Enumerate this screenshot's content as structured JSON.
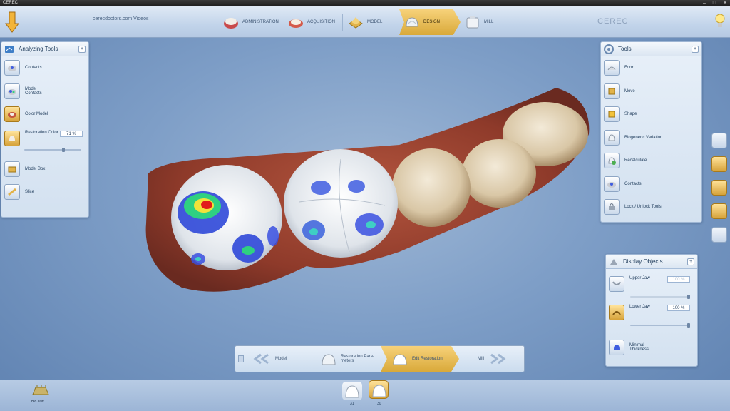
{
  "window": {
    "title": "CEREC",
    "controls": [
      "–",
      "□",
      "✕"
    ]
  },
  "header": {
    "site_label": "cerecdoctors.com Videos",
    "brand": "CEREC",
    "steps": [
      {
        "label": "ADMINISTRATION",
        "icon": "administration-icon",
        "active": false
      },
      {
        "label": "ACQUISITION",
        "icon": "acquisition-icon",
        "active": false
      },
      {
        "label": "MODEL",
        "icon": "model-icon",
        "active": false
      },
      {
        "label": "DESIGN",
        "icon": "design-icon",
        "active": true
      },
      {
        "label": "MILL",
        "icon": "mill-icon",
        "active": false
      }
    ]
  },
  "analyzing_tools": {
    "title": "Analyzing Tools",
    "items": [
      {
        "label": "Contacts",
        "icon": "contacts-icon"
      },
      {
        "label": "Model Contacts",
        "icon": "model-contacts-icon"
      },
      {
        "label": "Color Model",
        "icon": "color-model-icon"
      },
      {
        "label": "Restoration Color",
        "icon": "restoration-color-icon",
        "value": "71 %",
        "level_pct": 71
      },
      {
        "label": "Model Box",
        "icon": "model-box-icon"
      },
      {
        "label": "Slice",
        "icon": "slice-icon"
      }
    ]
  },
  "tools": {
    "title": "Tools",
    "items": [
      {
        "label": "Form",
        "icon": "form-icon"
      },
      {
        "label": "Move",
        "icon": "move-icon"
      },
      {
        "label": "Shape",
        "icon": "shape-icon"
      },
      {
        "label": "Biogeneric Variation",
        "icon": "biogeneric-variation-icon"
      },
      {
        "label": "Recalculate",
        "icon": "recalculate-icon"
      },
      {
        "label": "Contacts",
        "icon": "contacts-icon"
      },
      {
        "label": "Lock / Unlock Tools",
        "icon": "lock-icon"
      }
    ]
  },
  "display_objects": {
    "title": "Display Objects",
    "upper_jaw": {
      "label": "Upper Jaw",
      "value": "100 %",
      "level_pct": 100,
      "enabled": false
    },
    "lower_jaw": {
      "label": "Lower Jaw",
      "value": "100 %",
      "level_pct": 100,
      "enabled": true
    },
    "minimal_thickness": {
      "label": "Minimal Thickness"
    }
  },
  "workflow_bottom": {
    "steps": [
      {
        "label": "Model",
        "active": false
      },
      {
        "label": "Restoration Para-meters",
        "active": false
      },
      {
        "label": "Edit Restoration",
        "active": true
      },
      {
        "label": "Mill",
        "active": false
      }
    ]
  },
  "bottom_bar": {
    "bio_jaw_label": "Bio Jaw",
    "teeth": [
      {
        "number": "31",
        "active": false
      },
      {
        "number": "30",
        "active": true
      }
    ]
  },
  "colors": {
    "accent_gold": "#e2b34a",
    "panel_bg": "#dde8f4",
    "background": "#7e9ec7"
  }
}
